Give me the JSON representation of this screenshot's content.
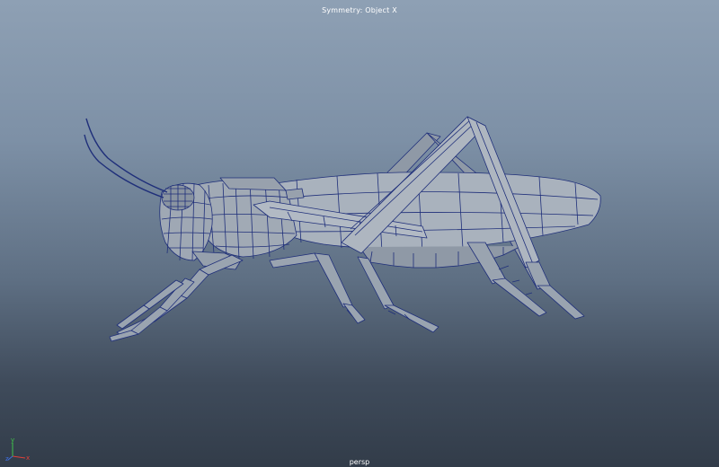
{
  "viewport": {
    "hud_title": "Symmetry: Object X",
    "camera_label": "persp",
    "background_top_color": "#8ea0b4",
    "background_bottom_color": "#323c49"
  },
  "model": {
    "wire_color": "#1f2f7a",
    "fill_color": "#a4adb8",
    "shade_color": "#7d8794"
  },
  "axis_gizmo": {
    "x_label": "x",
    "y_label": "y",
    "z_label": "z",
    "x_color": "#e0413a",
    "y_color": "#3fc24a",
    "z_color": "#3d6fe0"
  }
}
